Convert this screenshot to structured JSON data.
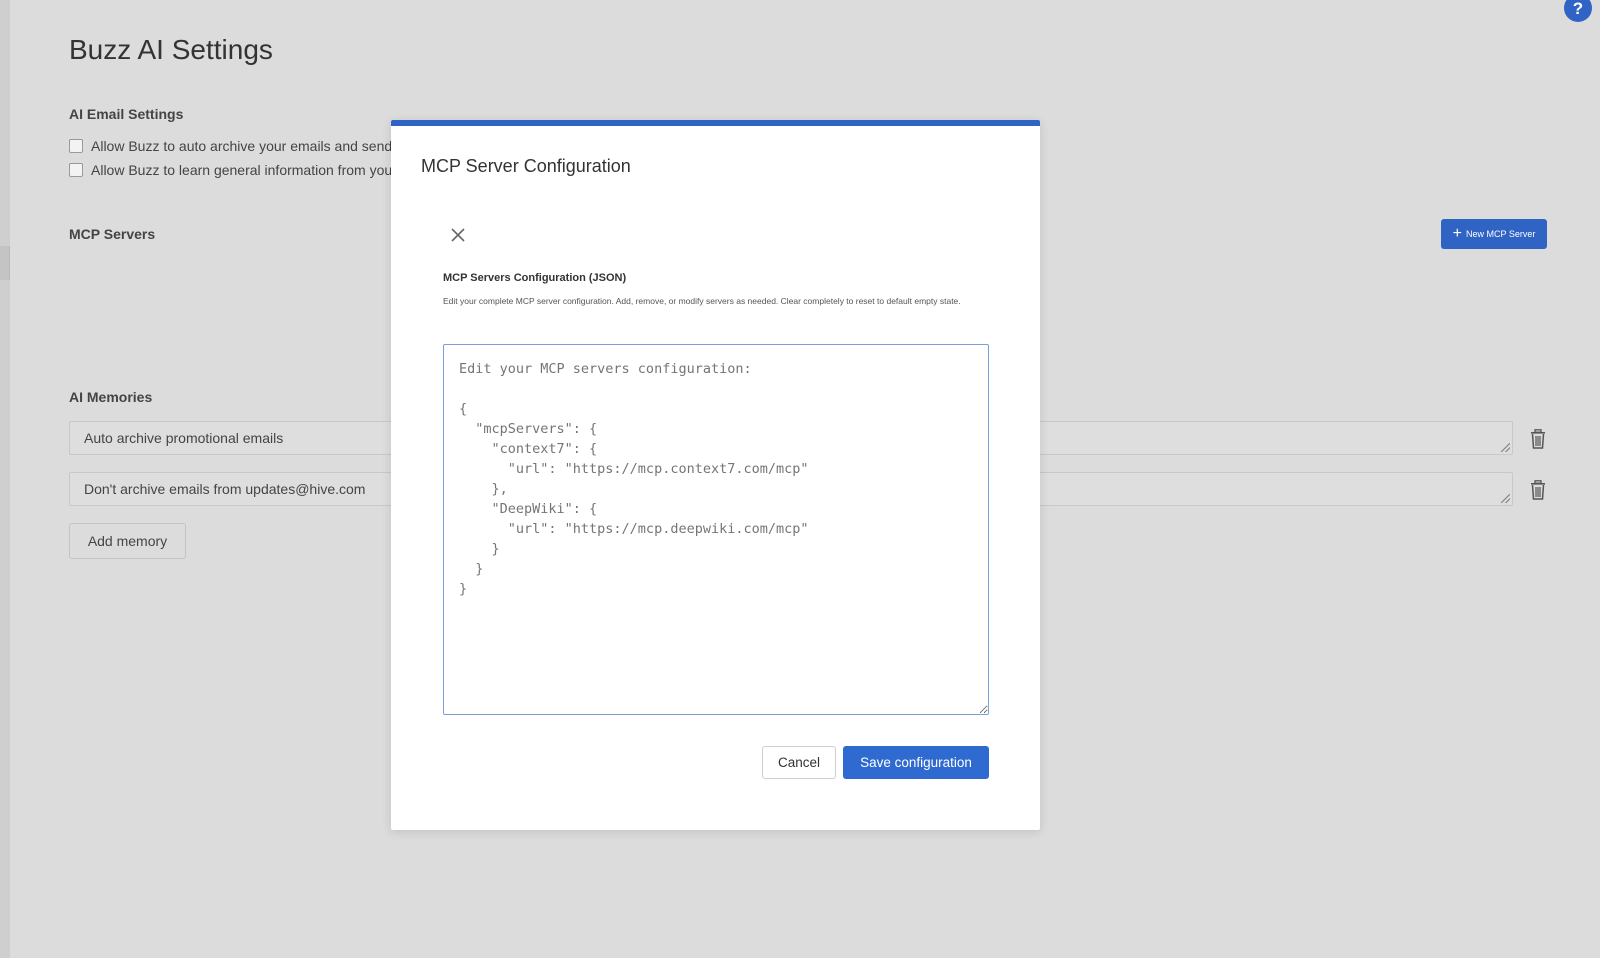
{
  "help": {
    "label": "?"
  },
  "page": {
    "title": "Buzz AI Settings",
    "email_settings": {
      "heading": "AI Email Settings",
      "options": [
        {
          "label": "Allow Buzz to auto archive your emails and send y",
          "checked": false
        },
        {
          "label": "Allow Buzz to learn general information from your",
          "checked": false
        }
      ]
    },
    "mcp_servers": {
      "heading": "MCP Servers",
      "new_button_label": "New MCP Server"
    },
    "memories": {
      "heading": "AI Memories",
      "items": [
        "Auto archive promotional emails",
        "Don't archive emails from updates@hive.com"
      ],
      "add_button_label": "Add memory"
    }
  },
  "modal": {
    "title": "MCP Server Configuration",
    "config_label": "MCP Servers Configuration (JSON)",
    "config_help": "Edit your complete MCP server configuration. Add, remove, or modify servers as needed. Clear completely to reset to default empty state.",
    "textarea_value": "",
    "textarea_placeholder": "Edit your MCP servers configuration:\n\n{\n  \"mcpServers\": {\n    \"context7\": {\n      \"url\": \"https://mcp.context7.com/mcp\"\n    },\n    \"DeepWiki\": {\n      \"url\": \"https://mcp.deepwiki.com/mcp\"\n    }\n  }\n}",
    "cancel_label": "Cancel",
    "save_label": "Save configuration"
  },
  "colors": {
    "accent": "#2f63c4",
    "page_background": "#dcdcdc",
    "modal_background": "#ffffff"
  },
  "icons": [
    "close-icon",
    "plus-icon",
    "trash-icon",
    "help-icon"
  ]
}
